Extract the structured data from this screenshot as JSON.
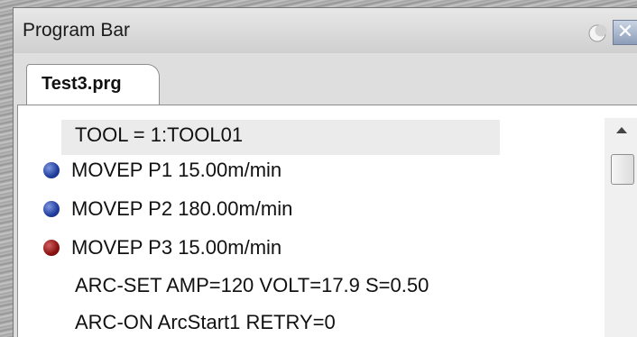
{
  "window": {
    "title": "Program Bar",
    "pin_icon": "pin-icon",
    "close_icon": "close-icon"
  },
  "tabs": [
    {
      "label": "Test3.prg",
      "active": true
    }
  ],
  "program": {
    "lines": [
      {
        "text": "TOOL = 1:TOOL01",
        "marker": "none",
        "selected": true
      },
      {
        "text": "MOVEP P1 15.00m/min",
        "marker": "blue"
      },
      {
        "text": "MOVEP P2 180.00m/min",
        "marker": "blue"
      },
      {
        "text": "MOVEP P3 15.00m/min",
        "marker": "red"
      },
      {
        "text": "ARC-SET AMP=120 VOLT=17.9 S=0.50",
        "marker": "none"
      },
      {
        "text": "ARC-ON ArcStart1 RETRY=0",
        "marker": "none"
      }
    ]
  },
  "colors": {
    "marker_blue": "#1f3c9c",
    "marker_red": "#8a1010"
  }
}
